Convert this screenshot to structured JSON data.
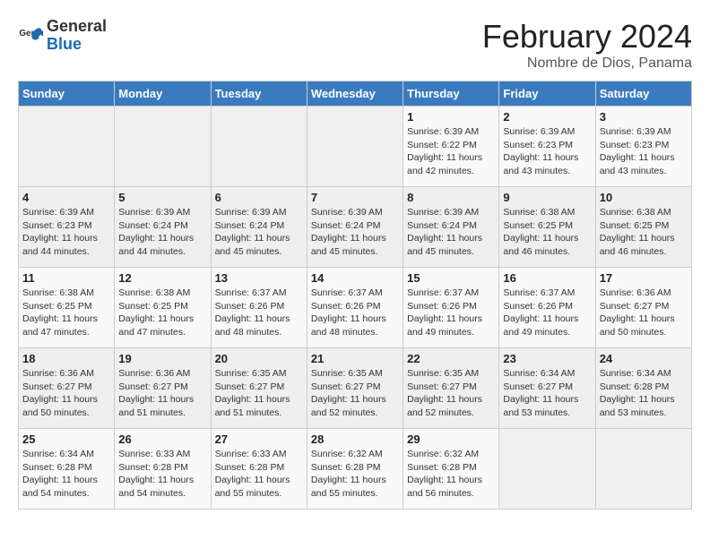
{
  "logo": {
    "line1": "General",
    "line2": "Blue"
  },
  "calendar": {
    "title": "February 2024",
    "subtitle": "Nombre de Dios, Panama"
  },
  "days_of_week": [
    "Sunday",
    "Monday",
    "Tuesday",
    "Wednesday",
    "Thursday",
    "Friday",
    "Saturday"
  ],
  "weeks": [
    [
      {
        "num": "",
        "info": ""
      },
      {
        "num": "",
        "info": ""
      },
      {
        "num": "",
        "info": ""
      },
      {
        "num": "",
        "info": ""
      },
      {
        "num": "1",
        "info": "Sunrise: 6:39 AM\nSunset: 6:22 PM\nDaylight: 11 hours\nand 42 minutes."
      },
      {
        "num": "2",
        "info": "Sunrise: 6:39 AM\nSunset: 6:23 PM\nDaylight: 11 hours\nand 43 minutes."
      },
      {
        "num": "3",
        "info": "Sunrise: 6:39 AM\nSunset: 6:23 PM\nDaylight: 11 hours\nand 43 minutes."
      }
    ],
    [
      {
        "num": "4",
        "info": "Sunrise: 6:39 AM\nSunset: 6:23 PM\nDaylight: 11 hours\nand 44 minutes."
      },
      {
        "num": "5",
        "info": "Sunrise: 6:39 AM\nSunset: 6:24 PM\nDaylight: 11 hours\nand 44 minutes."
      },
      {
        "num": "6",
        "info": "Sunrise: 6:39 AM\nSunset: 6:24 PM\nDaylight: 11 hours\nand 45 minutes."
      },
      {
        "num": "7",
        "info": "Sunrise: 6:39 AM\nSunset: 6:24 PM\nDaylight: 11 hours\nand 45 minutes."
      },
      {
        "num": "8",
        "info": "Sunrise: 6:39 AM\nSunset: 6:24 PM\nDaylight: 11 hours\nand 45 minutes."
      },
      {
        "num": "9",
        "info": "Sunrise: 6:38 AM\nSunset: 6:25 PM\nDaylight: 11 hours\nand 46 minutes."
      },
      {
        "num": "10",
        "info": "Sunrise: 6:38 AM\nSunset: 6:25 PM\nDaylight: 11 hours\nand 46 minutes."
      }
    ],
    [
      {
        "num": "11",
        "info": "Sunrise: 6:38 AM\nSunset: 6:25 PM\nDaylight: 11 hours\nand 47 minutes."
      },
      {
        "num": "12",
        "info": "Sunrise: 6:38 AM\nSunset: 6:25 PM\nDaylight: 11 hours\nand 47 minutes."
      },
      {
        "num": "13",
        "info": "Sunrise: 6:37 AM\nSunset: 6:26 PM\nDaylight: 11 hours\nand 48 minutes."
      },
      {
        "num": "14",
        "info": "Sunrise: 6:37 AM\nSunset: 6:26 PM\nDaylight: 11 hours\nand 48 minutes."
      },
      {
        "num": "15",
        "info": "Sunrise: 6:37 AM\nSunset: 6:26 PM\nDaylight: 11 hours\nand 49 minutes."
      },
      {
        "num": "16",
        "info": "Sunrise: 6:37 AM\nSunset: 6:26 PM\nDaylight: 11 hours\nand 49 minutes."
      },
      {
        "num": "17",
        "info": "Sunrise: 6:36 AM\nSunset: 6:27 PM\nDaylight: 11 hours\nand 50 minutes."
      }
    ],
    [
      {
        "num": "18",
        "info": "Sunrise: 6:36 AM\nSunset: 6:27 PM\nDaylight: 11 hours\nand 50 minutes."
      },
      {
        "num": "19",
        "info": "Sunrise: 6:36 AM\nSunset: 6:27 PM\nDaylight: 11 hours\nand 51 minutes."
      },
      {
        "num": "20",
        "info": "Sunrise: 6:35 AM\nSunset: 6:27 PM\nDaylight: 11 hours\nand 51 minutes."
      },
      {
        "num": "21",
        "info": "Sunrise: 6:35 AM\nSunset: 6:27 PM\nDaylight: 11 hours\nand 52 minutes."
      },
      {
        "num": "22",
        "info": "Sunrise: 6:35 AM\nSunset: 6:27 PM\nDaylight: 11 hours\nand 52 minutes."
      },
      {
        "num": "23",
        "info": "Sunrise: 6:34 AM\nSunset: 6:27 PM\nDaylight: 11 hours\nand 53 minutes."
      },
      {
        "num": "24",
        "info": "Sunrise: 6:34 AM\nSunset: 6:28 PM\nDaylight: 11 hours\nand 53 minutes."
      }
    ],
    [
      {
        "num": "25",
        "info": "Sunrise: 6:34 AM\nSunset: 6:28 PM\nDaylight: 11 hours\nand 54 minutes."
      },
      {
        "num": "26",
        "info": "Sunrise: 6:33 AM\nSunset: 6:28 PM\nDaylight: 11 hours\nand 54 minutes."
      },
      {
        "num": "27",
        "info": "Sunrise: 6:33 AM\nSunset: 6:28 PM\nDaylight: 11 hours\nand 55 minutes."
      },
      {
        "num": "28",
        "info": "Sunrise: 6:32 AM\nSunset: 6:28 PM\nDaylight: 11 hours\nand 55 minutes."
      },
      {
        "num": "29",
        "info": "Sunrise: 6:32 AM\nSunset: 6:28 PM\nDaylight: 11 hours\nand 56 minutes."
      },
      {
        "num": "",
        "info": ""
      },
      {
        "num": "",
        "info": ""
      }
    ]
  ]
}
